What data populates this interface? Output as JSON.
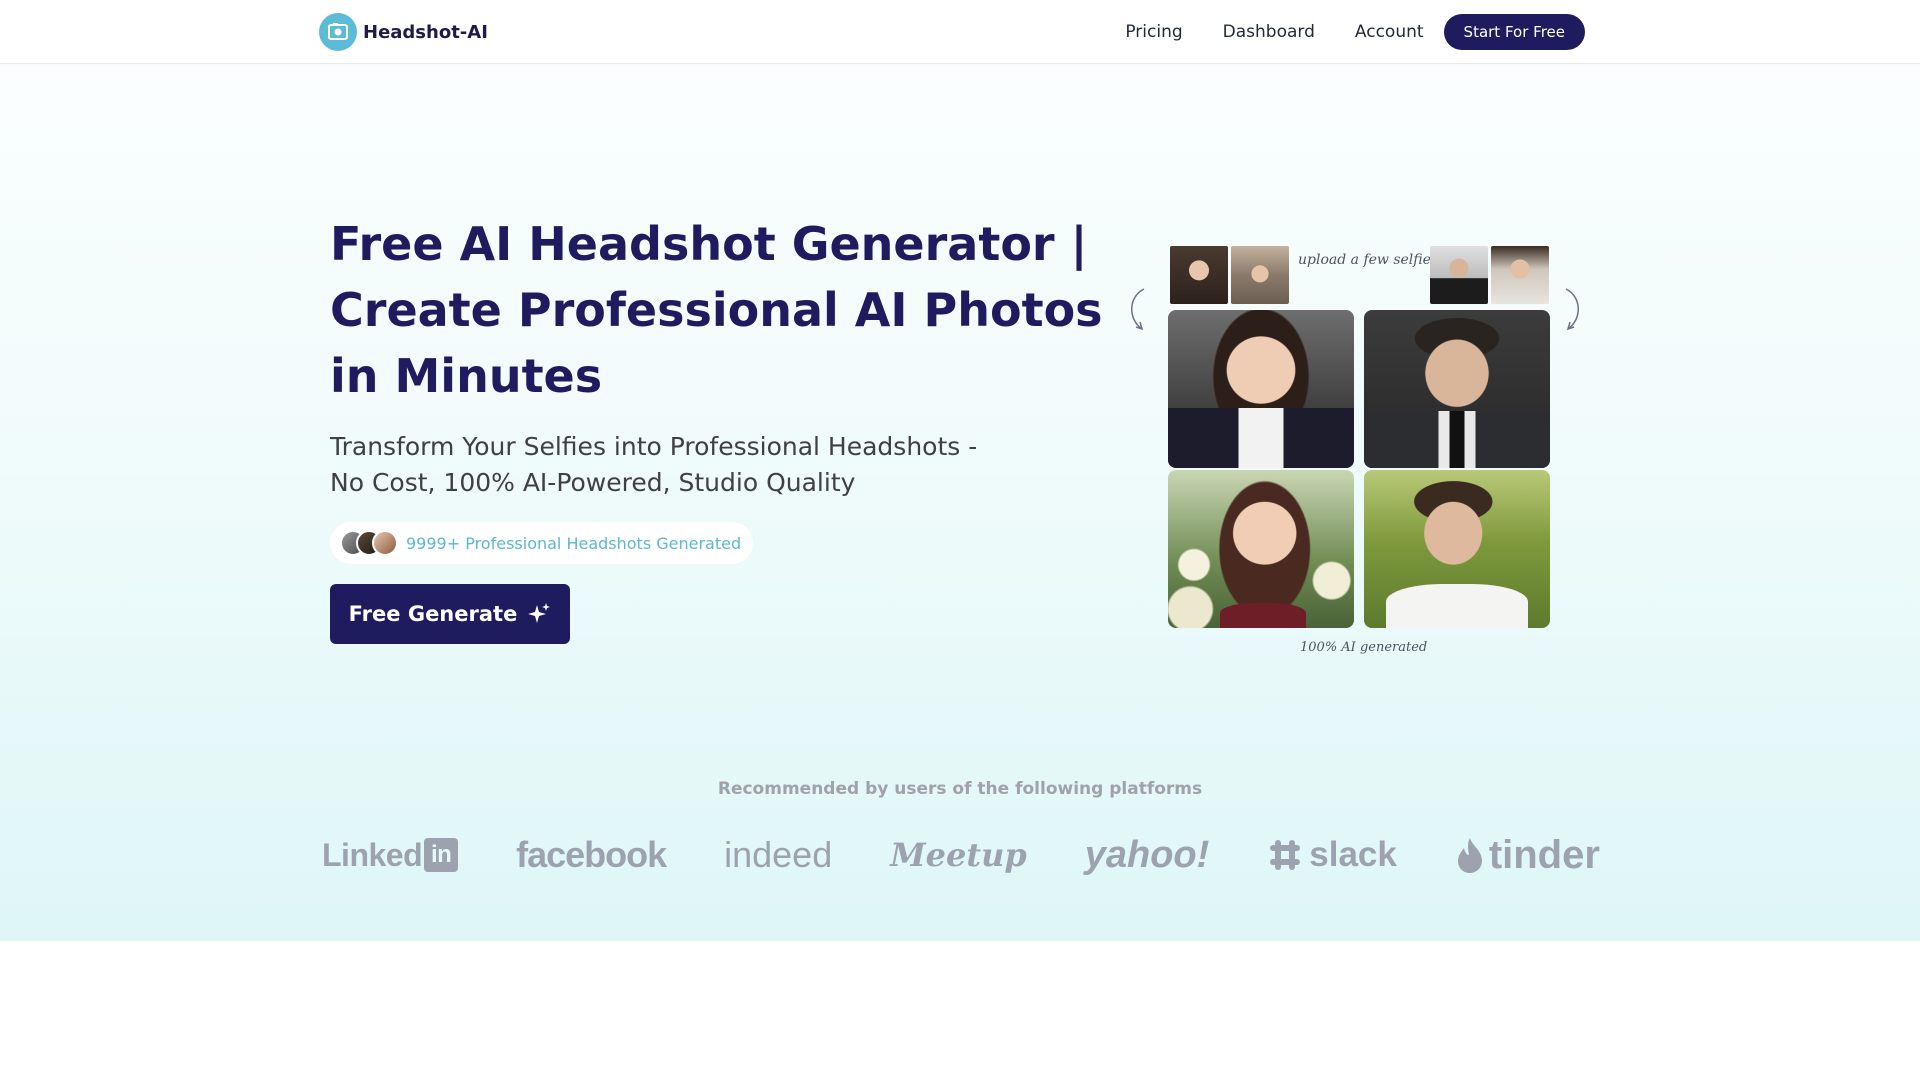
{
  "header": {
    "brand": "Headshot-AI",
    "nav": [
      {
        "label": "Pricing"
      },
      {
        "label": "Dashboard"
      },
      {
        "label": "Account"
      }
    ],
    "cta_label": "Start For Free"
  },
  "hero": {
    "title": "Free AI Headshot Generator | Create Professional AI Photos in Minutes",
    "subtitle": "Transform Your Selfies into Professional Headshots - No Cost, 100% AI-Powered, Studio Quality",
    "badge_text": "9999+ Professional Headshots Generated",
    "button_label": "Free Generate"
  },
  "gallery": {
    "upload_note": "upload a few selfies",
    "ai_note": "100% AI generated"
  },
  "platforms": {
    "heading": "Recommended by users of the following platforms",
    "items": [
      {
        "name": "Linked",
        "icon": "linkedin-logo"
      },
      {
        "name": "facebook",
        "icon": "facebook-logo"
      },
      {
        "name": "indeed",
        "icon": "indeed-logo"
      },
      {
        "name": "Meetup",
        "icon": "meetup-logo"
      },
      {
        "name": "yahoo!",
        "icon": "yahoo-logo"
      },
      {
        "name": "slack",
        "icon": "slack-logo"
      },
      {
        "name": "tinder",
        "icon": "tinder-logo"
      }
    ]
  },
  "colors": {
    "brand_navy": "#1e1b5e",
    "accent_cyan": "#5bbbd8",
    "logo_gray": "#9ca3af"
  }
}
